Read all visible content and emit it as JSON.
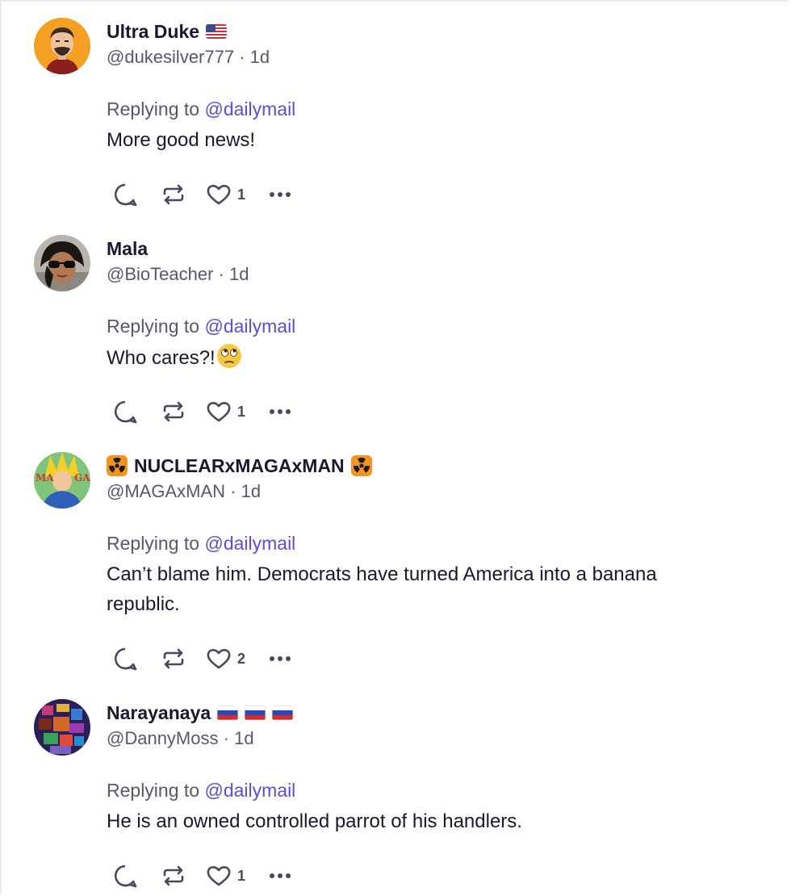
{
  "posts": [
    {
      "display_name": "Ultra Duke",
      "name_flags": [
        "us-flag"
      ],
      "handle": "@dukesilver777",
      "time": "1d",
      "replying_prefix": "Replying to",
      "replying_to": "@dailymail",
      "text": "More good news!",
      "emoji": null,
      "like_count": "1"
    },
    {
      "display_name": "Mala",
      "name_flags": [],
      "handle": "@BioTeacher",
      "time": "1d",
      "replying_prefix": "Replying to",
      "replying_to": "@dailymail",
      "text": "Who cares?!",
      "emoji": "eye-roll-emoji",
      "like_count": "1"
    },
    {
      "display_name": "NUCLEARxMAGAxMAN",
      "name_flags": [
        "radioactive-icon"
      ],
      "handle": "@MAGAxMAN",
      "time": "1d",
      "replying_prefix": "Replying to",
      "replying_to": "@dailymail",
      "text": "Can’t blame him. Democrats have turned America into a banana republic.",
      "emoji": null,
      "like_count": "2"
    },
    {
      "display_name": "Narayanaya",
      "name_flags": [
        "russia-flag",
        "russia-flag",
        "russia-flag"
      ],
      "handle": "@DannyMoss",
      "time": "1d",
      "replying_prefix": "Replying to",
      "replying_to": "@dailymail",
      "text": "He is an owned controlled parrot of his handlers.",
      "emoji": null,
      "like_count": "1"
    }
  ],
  "separator": "·",
  "icons": {
    "reply": "reply-icon",
    "repost": "repost-icon",
    "like": "heart-icon",
    "more": "more-icon"
  },
  "colors": {
    "mention": "#5a4fd0",
    "secondary_text": "#5a5670",
    "primary_text": "#1b1730",
    "frame_border": "#ece9f3"
  }
}
